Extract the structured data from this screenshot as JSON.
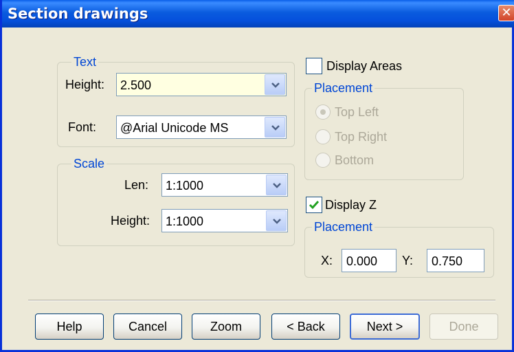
{
  "window": {
    "title": "Section drawings",
    "close_glyph": "✕"
  },
  "text_group": {
    "legend": "Text",
    "height_label": "Height:",
    "height_value": "2.500",
    "font_label": "Font:",
    "font_value": "@Arial Unicode MS"
  },
  "scale_group": {
    "legend": "Scale",
    "len_label": "Len:",
    "len_value": "1:1000",
    "height_label": "Height:",
    "height_value": "1:1000"
  },
  "display_areas": {
    "label": "Display Areas",
    "checked": false,
    "placement_legend": "Placement",
    "options": [
      "Top Left",
      "Top Right",
      "Bottom"
    ],
    "selected": "Top Left",
    "enabled": false
  },
  "display_z": {
    "label": "Display Z",
    "checked": true,
    "placement_legend": "Placement",
    "x_label": "X:",
    "x_value": "0.000",
    "y_label": "Y:",
    "y_value": "0.750"
  },
  "buttons": {
    "help": "Help",
    "cancel": "Cancel",
    "zoom": "Zoom",
    "back": "< Back",
    "next": "Next >",
    "done": "Done"
  },
  "icons": {
    "combo_arrow": "chevron-down-icon",
    "check": "check-icon",
    "close": "close-icon"
  },
  "colors": {
    "title_bar": "#0a5cde",
    "group_legend": "#0046d5",
    "dialog_bg": "#ece9d8",
    "highlight_field": "#ffffe1",
    "disabled_text": "#aca899",
    "close_button": "#d2452a"
  }
}
